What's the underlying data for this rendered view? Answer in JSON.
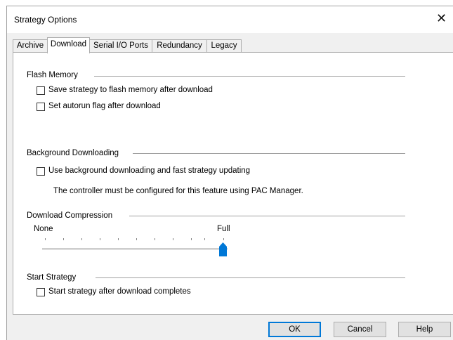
{
  "window": {
    "title": "Strategy Options",
    "close_glyph": "✕"
  },
  "tabs": [
    {
      "label": "Archive",
      "active": false
    },
    {
      "label": "Download",
      "active": true
    },
    {
      "label": "Serial I/O Ports",
      "active": false
    },
    {
      "label": "Redundancy",
      "active": false
    },
    {
      "label": "Legacy",
      "active": false
    }
  ],
  "flash_memory": {
    "heading": "Flash Memory",
    "save_to_flash": {
      "label": "Save strategy to flash memory after download",
      "checked": false
    },
    "autorun_flag": {
      "label": "Set autorun flag after download",
      "checked": false
    }
  },
  "background_downloading": {
    "heading": "Background Downloading",
    "use_background": {
      "label": "Use background downloading and fast strategy updating",
      "checked": false
    },
    "note": "The controller must be configured for this feature using PAC Manager."
  },
  "download_compression": {
    "heading": "Download Compression",
    "min_label": "None",
    "max_label": "Full",
    "level": 1.0,
    "thumb_color": "#0078d7"
  },
  "start_strategy": {
    "heading": "Start Strategy",
    "start_after_download": {
      "label": "Start strategy after download completes",
      "checked": false
    }
  },
  "buttons": {
    "ok": "OK",
    "cancel": "Cancel",
    "help": "Help"
  }
}
